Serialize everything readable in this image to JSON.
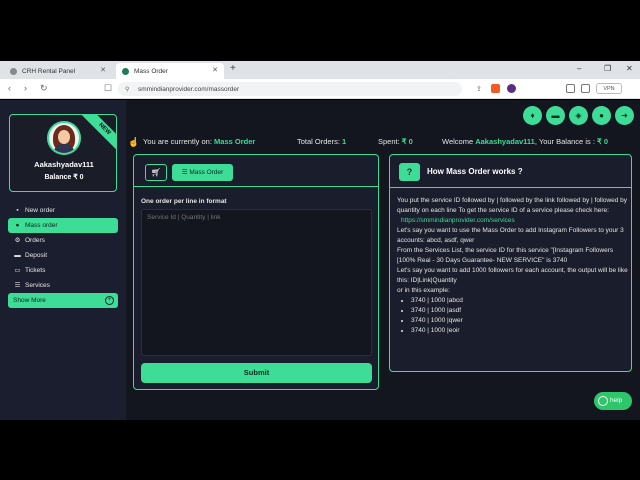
{
  "browser": {
    "tabs": [
      {
        "title": "CRH Rental Panel"
      },
      {
        "title": "Mass Order"
      }
    ],
    "url": "smmindianprovider.com/massorder",
    "vpn_label": "VPN"
  },
  "sidebar": {
    "ribbon": "NEW",
    "username": "Aakashyadav111",
    "balance": "Balance ₹ 0",
    "items": [
      {
        "label": "New order",
        "icon": "cart-icon"
      },
      {
        "label": "Mass order",
        "icon": "list-icon",
        "active": true
      },
      {
        "label": "Orders",
        "icon": "gear-icon"
      },
      {
        "label": "Deposit",
        "icon": "card-icon"
      },
      {
        "label": "Tickets",
        "icon": "ticket-icon"
      },
      {
        "label": "Services",
        "icon": "services-icon"
      }
    ],
    "show_more": "Show More"
  },
  "infobar": {
    "current_label": "You are currently on:",
    "current_value": "Mass Order",
    "total_label": "Total Orders:",
    "total_value": "1",
    "spent_label": "Spent:",
    "spent_value": "₹ 0",
    "welcome_label": "Welcome",
    "welcome_user": "Aakashyadav111",
    "balance_label": ", Your Balance is :",
    "balance_value": "₹ 0"
  },
  "form": {
    "mass_order_button": "Mass Order",
    "field_label": "One order per line in format",
    "placeholder": "Service Id | Quantity | link",
    "submit_label": "Submit"
  },
  "help_panel": {
    "icon": "?",
    "title": "How Mass Order works ?",
    "p1": "You put the service ID followed by | followed by the link followed by | followed by quantity on each line To get the service ID of a service please check here:",
    "link": "https://smmindianprovider.com/services",
    "p2": "Let's say you want to use the Mass Order to add Instagram Followers to your 3 accounts: abcd, asdf, qwer",
    "p3": "From the Services List, the service ID for this service \"[Instagram Followers [100% Real - 30 Days Guarantee- NEW SERVICE\" is 3740",
    "p4": "Let's say you want to add 1000 followers for each account, the output will be like this: ID|Link|Quantity",
    "p5": "or in this example:",
    "examples": [
      "3740 | 1000 |abcd",
      "3740 | 1000 |asdf",
      "3740 | 1000 |qwer",
      "3740 | 1000 |eoir"
    ]
  },
  "help_button": "help",
  "colors": {
    "accent": "#3ddc97",
    "background": "#13151f",
    "panel": "#1a1d2b"
  }
}
